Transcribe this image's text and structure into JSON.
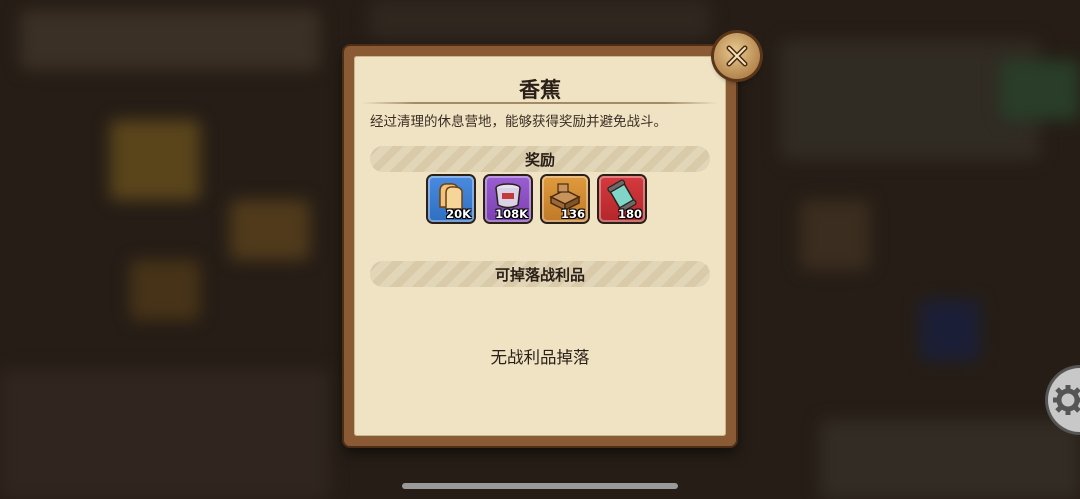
{
  "dialog": {
    "title": "香蕉",
    "description": "经过清理的休息营地，能够获得奖励并避免战斗。",
    "rewards_header": "奖励",
    "rewards": [
      {
        "icon": "bread-icon",
        "count": "20K",
        "color": "#2f6fc1"
      },
      {
        "icon": "pot-icon",
        "count": "108K",
        "color": "#7a3fb0"
      },
      {
        "icon": "wood-planks-icon",
        "count": "136",
        "color": "#c07a28"
      },
      {
        "icon": "canister-icon",
        "count": "180",
        "color": "#b3262b"
      }
    ],
    "loot_header": "可掉落战利品",
    "loot_empty": "无战利品掉落"
  }
}
